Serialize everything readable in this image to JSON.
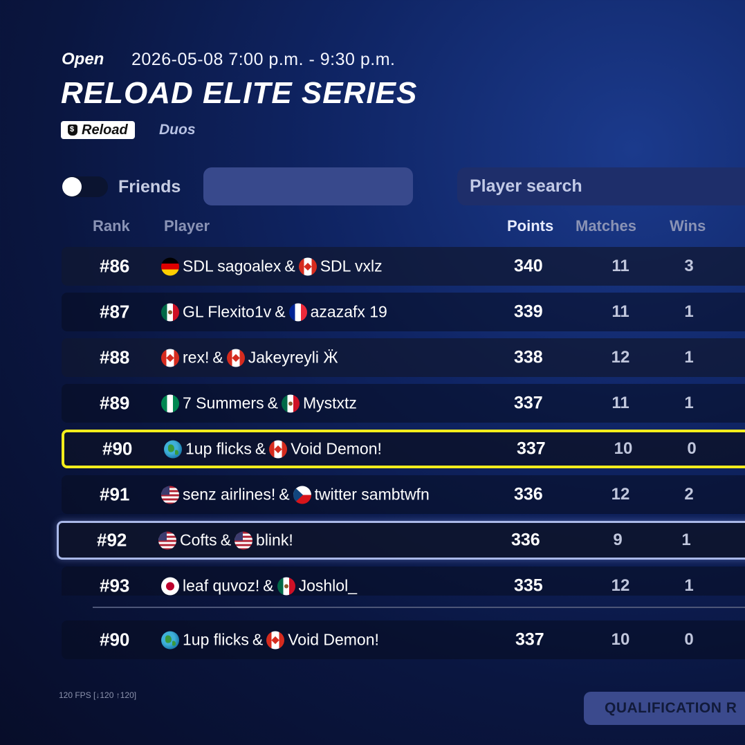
{
  "event": {
    "status": "Open",
    "datetime": "2026-05-08 7:00 p.m. - 9:30 p.m.",
    "title": "RELOAD ELITE SERIES",
    "mode": "Reload",
    "mode_icon": "money-bag-icon",
    "team_type": "Duos"
  },
  "filters": {
    "friends_label": "Friends",
    "friends_toggle_on": false,
    "search_placeholder": "Player search"
  },
  "columns": {
    "rank": "Rank",
    "player": "Player",
    "points": "Points",
    "matches": "Matches",
    "wins": "Wins"
  },
  "rows": [
    {
      "rank": "#86",
      "p1_flag": "de",
      "p1": "SDL sagoalex",
      "sep": "&",
      "p2_flag": "ca",
      "p2": "SDL vxlz",
      "points": "340",
      "matches": "11",
      "wins": "3"
    },
    {
      "rank": "#87",
      "p1_flag": "mx",
      "p1": "GL Flexito1v",
      "sep": "&",
      "p2_flag": "fr",
      "p2": "azazafx 19",
      "points": "339",
      "matches": "11",
      "wins": "1"
    },
    {
      "rank": "#88",
      "p1_flag": "ca",
      "p1": "rex!",
      "sep": "&",
      "p2_flag": "ca",
      "p2": "Jakeyreyli Ӝ",
      "points": "338",
      "matches": "12",
      "wins": "1"
    },
    {
      "rank": "#89",
      "p1_flag": "ng",
      "p1": "7 Summers",
      "sep": "&",
      "p2_flag": "mx",
      "p2": "Mystxtz",
      "points": "337",
      "matches": "11",
      "wins": "1"
    },
    {
      "rank": "#90",
      "p1_flag": "globe",
      "p1": "1up flicks",
      "sep": "&",
      "p2_flag": "ca",
      "p2": "Void Demon!",
      "points": "337",
      "matches": "10",
      "wins": "0"
    },
    {
      "rank": "#91",
      "p1_flag": "us",
      "p1": "senz airlines!",
      "sep": "&",
      "p2_flag": "cz",
      "p2": "twitter sambtwfn",
      "points": "336",
      "matches": "12",
      "wins": "2"
    },
    {
      "rank": "#92",
      "p1_flag": "us",
      "p1": "Cofts",
      "sep": "&",
      "p2_flag": "us",
      "p2": "blink!",
      "points": "336",
      "matches": "9",
      "wins": "1"
    },
    {
      "rank": "#93",
      "p1_flag": "jp",
      "p1": "leaf quvoz!",
      "sep": "&",
      "p2_flag": "mx",
      "p2": "Joshlol_",
      "points": "335",
      "matches": "12",
      "wins": "1"
    }
  ],
  "my_team": {
    "rank": "#90",
    "p1_flag": "globe",
    "p1": "1up flicks",
    "sep": "&",
    "p2_flag": "ca",
    "p2": "Void Demon!",
    "points": "337",
    "matches": "10",
    "wins": "0"
  },
  "footer": {
    "fps": "120 FPS [↓120 ↑120]",
    "qualification_button": "QUALIFICATION R"
  },
  "colors": {
    "highlight_border": "#f2ec1c",
    "focus_border": "#a9b8e8",
    "accent": "#38498c"
  }
}
